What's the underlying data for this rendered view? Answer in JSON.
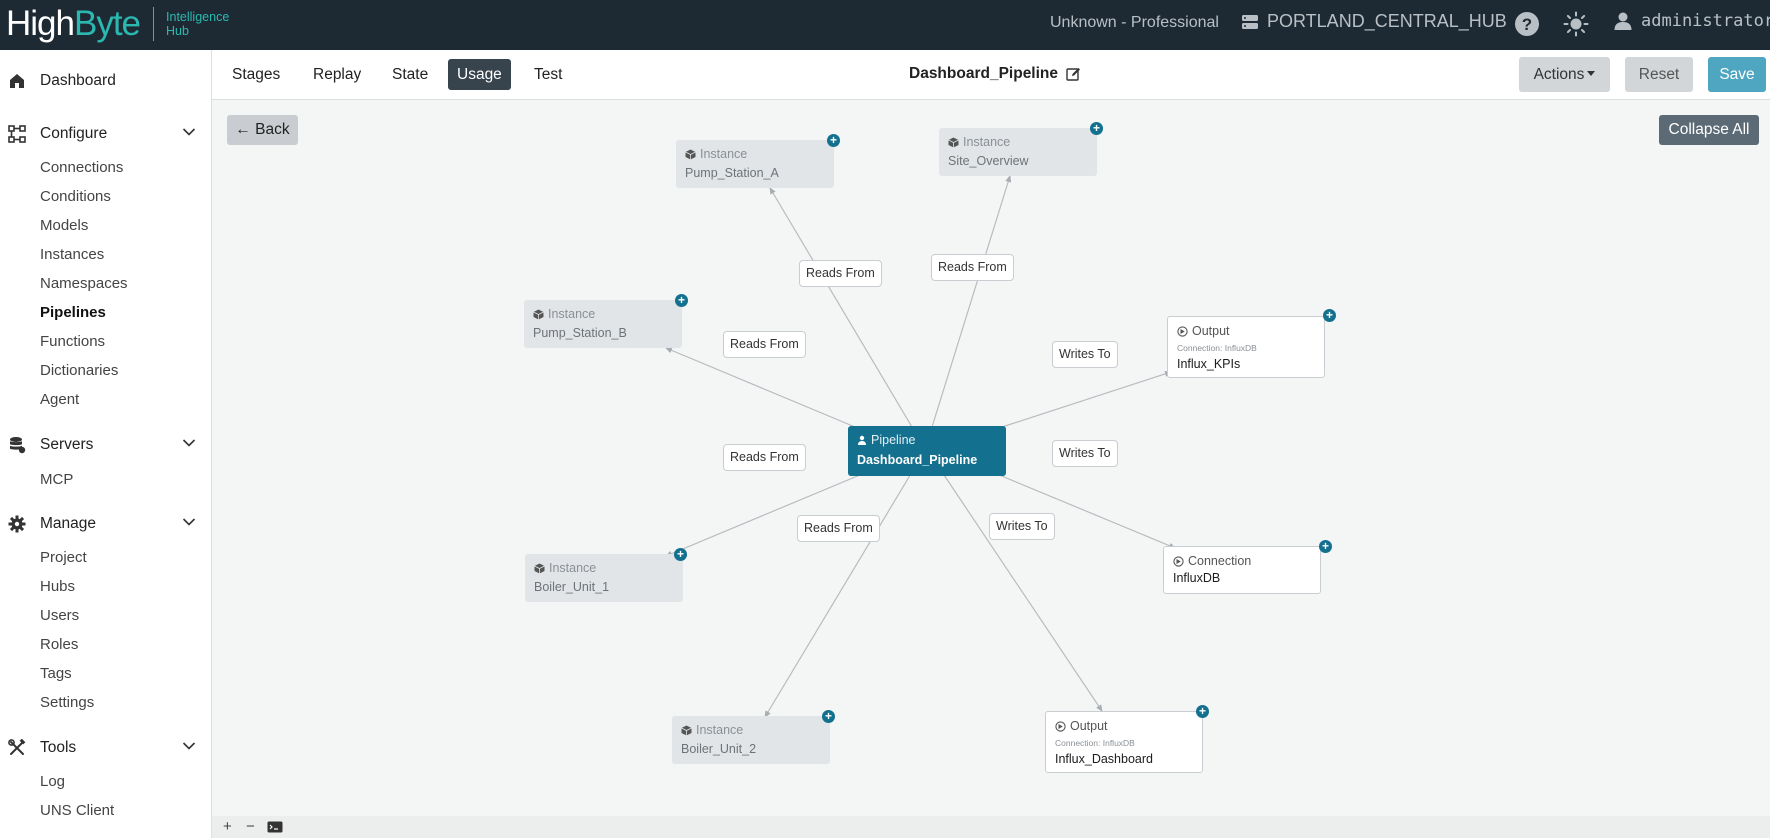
{
  "app": {
    "logo_high": "High",
    "logo_byte": "Byte",
    "logo_sub_line1": "Intelligence",
    "logo_sub_line2": "Hub",
    "license": "Unknown - Professional",
    "hub_name": "PORTLAND_CENTRAL_HUB",
    "user": "administrator"
  },
  "sidebar": {
    "dashboard": "Dashboard",
    "configure": {
      "label": "Configure",
      "items": [
        "Connections",
        "Conditions",
        "Models",
        "Instances",
        "Namespaces",
        "Pipelines",
        "Functions",
        "Dictionaries",
        "Agent"
      ],
      "active": "Pipelines"
    },
    "servers": {
      "label": "Servers",
      "items": [
        "MCP"
      ]
    },
    "manage": {
      "label": "Manage",
      "items": [
        "Project",
        "Hubs",
        "Users",
        "Roles",
        "Tags",
        "Settings"
      ]
    },
    "tools": {
      "label": "Tools",
      "items": [
        "Log",
        "UNS Client"
      ]
    }
  },
  "toolbar": {
    "tabs": [
      "Stages",
      "Replay",
      "State",
      "Usage",
      "Test"
    ],
    "active_tab": "Usage",
    "pipeline_title": "Dashboard_Pipeline",
    "actions": "Actions",
    "reset": "Reset",
    "save": "Save"
  },
  "canvas": {
    "back": "Back",
    "collapse_all": "Collapse All",
    "center": {
      "type": "Pipeline",
      "name": "Dashboard_Pipeline"
    },
    "nodes": [
      {
        "id": "pump_a",
        "type": "Instance",
        "name": "Pump_Station_A",
        "relation": "Reads From"
      },
      {
        "id": "site",
        "type": "Instance",
        "name": "Site_Overview",
        "relation": "Reads From"
      },
      {
        "id": "pump_b",
        "type": "Instance",
        "name": "Pump_Station_B",
        "relation": "Reads From"
      },
      {
        "id": "kpis",
        "type": "Output",
        "connection": "Connection: InfluxDB",
        "name": "Influx_KPIs",
        "relation": "Writes To"
      },
      {
        "id": "boiler1",
        "type": "Instance",
        "name": "Boiler_Unit_1",
        "relation": "Reads From"
      },
      {
        "id": "influxdb",
        "type": "Connection",
        "name": "InfluxDB",
        "relation": "Writes To"
      },
      {
        "id": "boiler2",
        "type": "Instance",
        "name": "Boiler_Unit_2",
        "relation": "Reads From"
      },
      {
        "id": "dash",
        "type": "Output",
        "connection": "Connection: InfluxDB",
        "name": "Influx_Dashboard",
        "relation": "Writes To"
      }
    ],
    "colors": {
      "pipeline": "#13708f",
      "instance_bg": "#e2e5e7",
      "edge": "#b8bcc0"
    }
  },
  "bottom": {
    "zoom_in": "+",
    "zoom_out": "−"
  }
}
